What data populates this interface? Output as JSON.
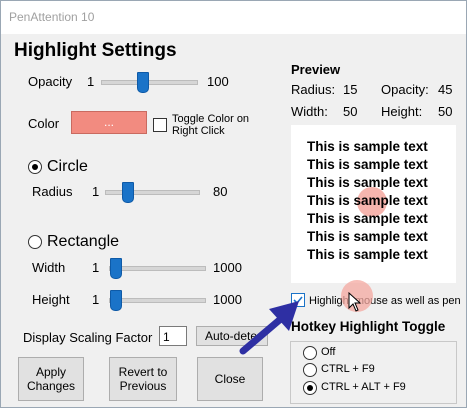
{
  "window": {
    "title": "PenAttention 10"
  },
  "heading": "Highlight Settings",
  "opacity": {
    "label": "Opacity",
    "min": "1",
    "max": "100"
  },
  "color": {
    "label": "Color",
    "button_label": "...",
    "swatch": "#f28b80",
    "toggle_label_line1": "Toggle Color on",
    "toggle_label_line2": "Right Click"
  },
  "circle": {
    "label": "Circle",
    "radius_label": "Radius",
    "min": "1",
    "max": "80"
  },
  "rectangle": {
    "label": "Rectangle",
    "width_label": "Width",
    "height_label": "Height",
    "min": "1",
    "max": "1000"
  },
  "scaling": {
    "label": "Display Scaling Factor",
    "value": "1",
    "auto_label": "Auto-dete"
  },
  "buttons": {
    "apply_line1": "Apply",
    "apply_line2": "Changes",
    "revert_line1": "Revert to",
    "revert_line2": "Previous",
    "close": "Close"
  },
  "preview": {
    "heading": "Preview",
    "radius_label": "Radius:",
    "radius_value": "15",
    "opacity_label": "Opacity:",
    "opacity_value": "45",
    "width_label": "Width:",
    "width_value": "50",
    "height_label": "Height:",
    "height_value": "50",
    "sample_lines": [
      "This is sample text",
      "This is sample text",
      "This is sample text",
      "This is sample text",
      "This is sample text",
      "This is sample text",
      "This is sample text"
    ],
    "highlight_color": "#f4a8a0"
  },
  "highlight_mouse": {
    "label": "Highlight mouse as well as pen",
    "checked": true
  },
  "hotkey": {
    "heading": "Hotkey Highlight Toggle",
    "options": [
      "Off",
      "CTRL + F9",
      "CTRL + ALT + F9"
    ],
    "selected": "CTRL + ALT + F9"
  },
  "colors": {
    "accent": "#1a73c8",
    "arrow": "#2e2fa3"
  }
}
